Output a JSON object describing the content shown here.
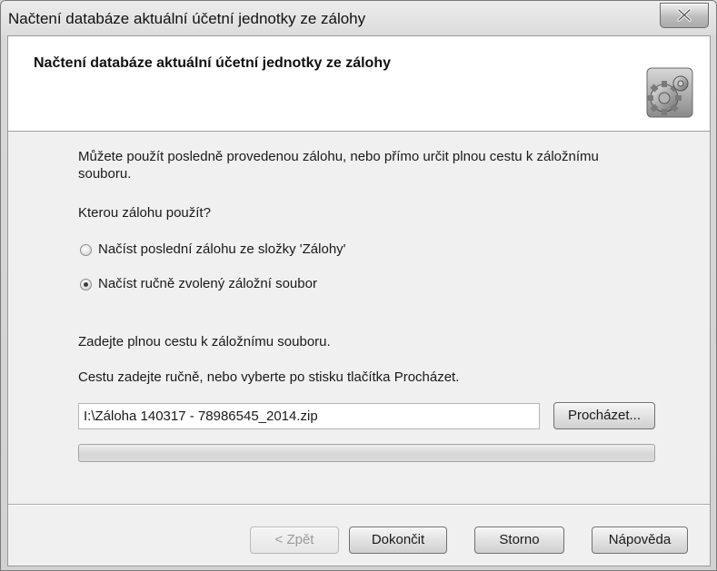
{
  "window": {
    "title": "Načtení databáze aktuální účetní jednotky ze zálohy"
  },
  "header": {
    "title": "Načtení databáze aktuální účetní jednotky ze zálohy",
    "icon": "gear-icon"
  },
  "content": {
    "intro_line1": "Můžete použít posledně provedenou zálohu, nebo přímo určit plnou cestu k záložnímu",
    "intro_line2": "souboru.",
    "question": "Kterou zálohu použít?",
    "options": [
      {
        "label": "Načíst poslední zálohu ze složky 'Zálohy'",
        "selected": false
      },
      {
        "label": "Načíst ručně zvolený záložní soubor",
        "selected": true
      }
    ],
    "path_prompt": "Zadejte plnou cestu k záložnímu souboru.",
    "path_hint": "Cestu zadejte ručně, nebo vyberte po stisku tlačítka Procházet.",
    "path_value": "I:\\Záloha 140317 - 78986545_2014.zip",
    "browse_label": "Procházet...",
    "progress": 0
  },
  "footer": {
    "back_label": "< Zpět",
    "finish_label": "Dokončit",
    "cancel_label": "Storno",
    "help_label": "Nápověda"
  }
}
